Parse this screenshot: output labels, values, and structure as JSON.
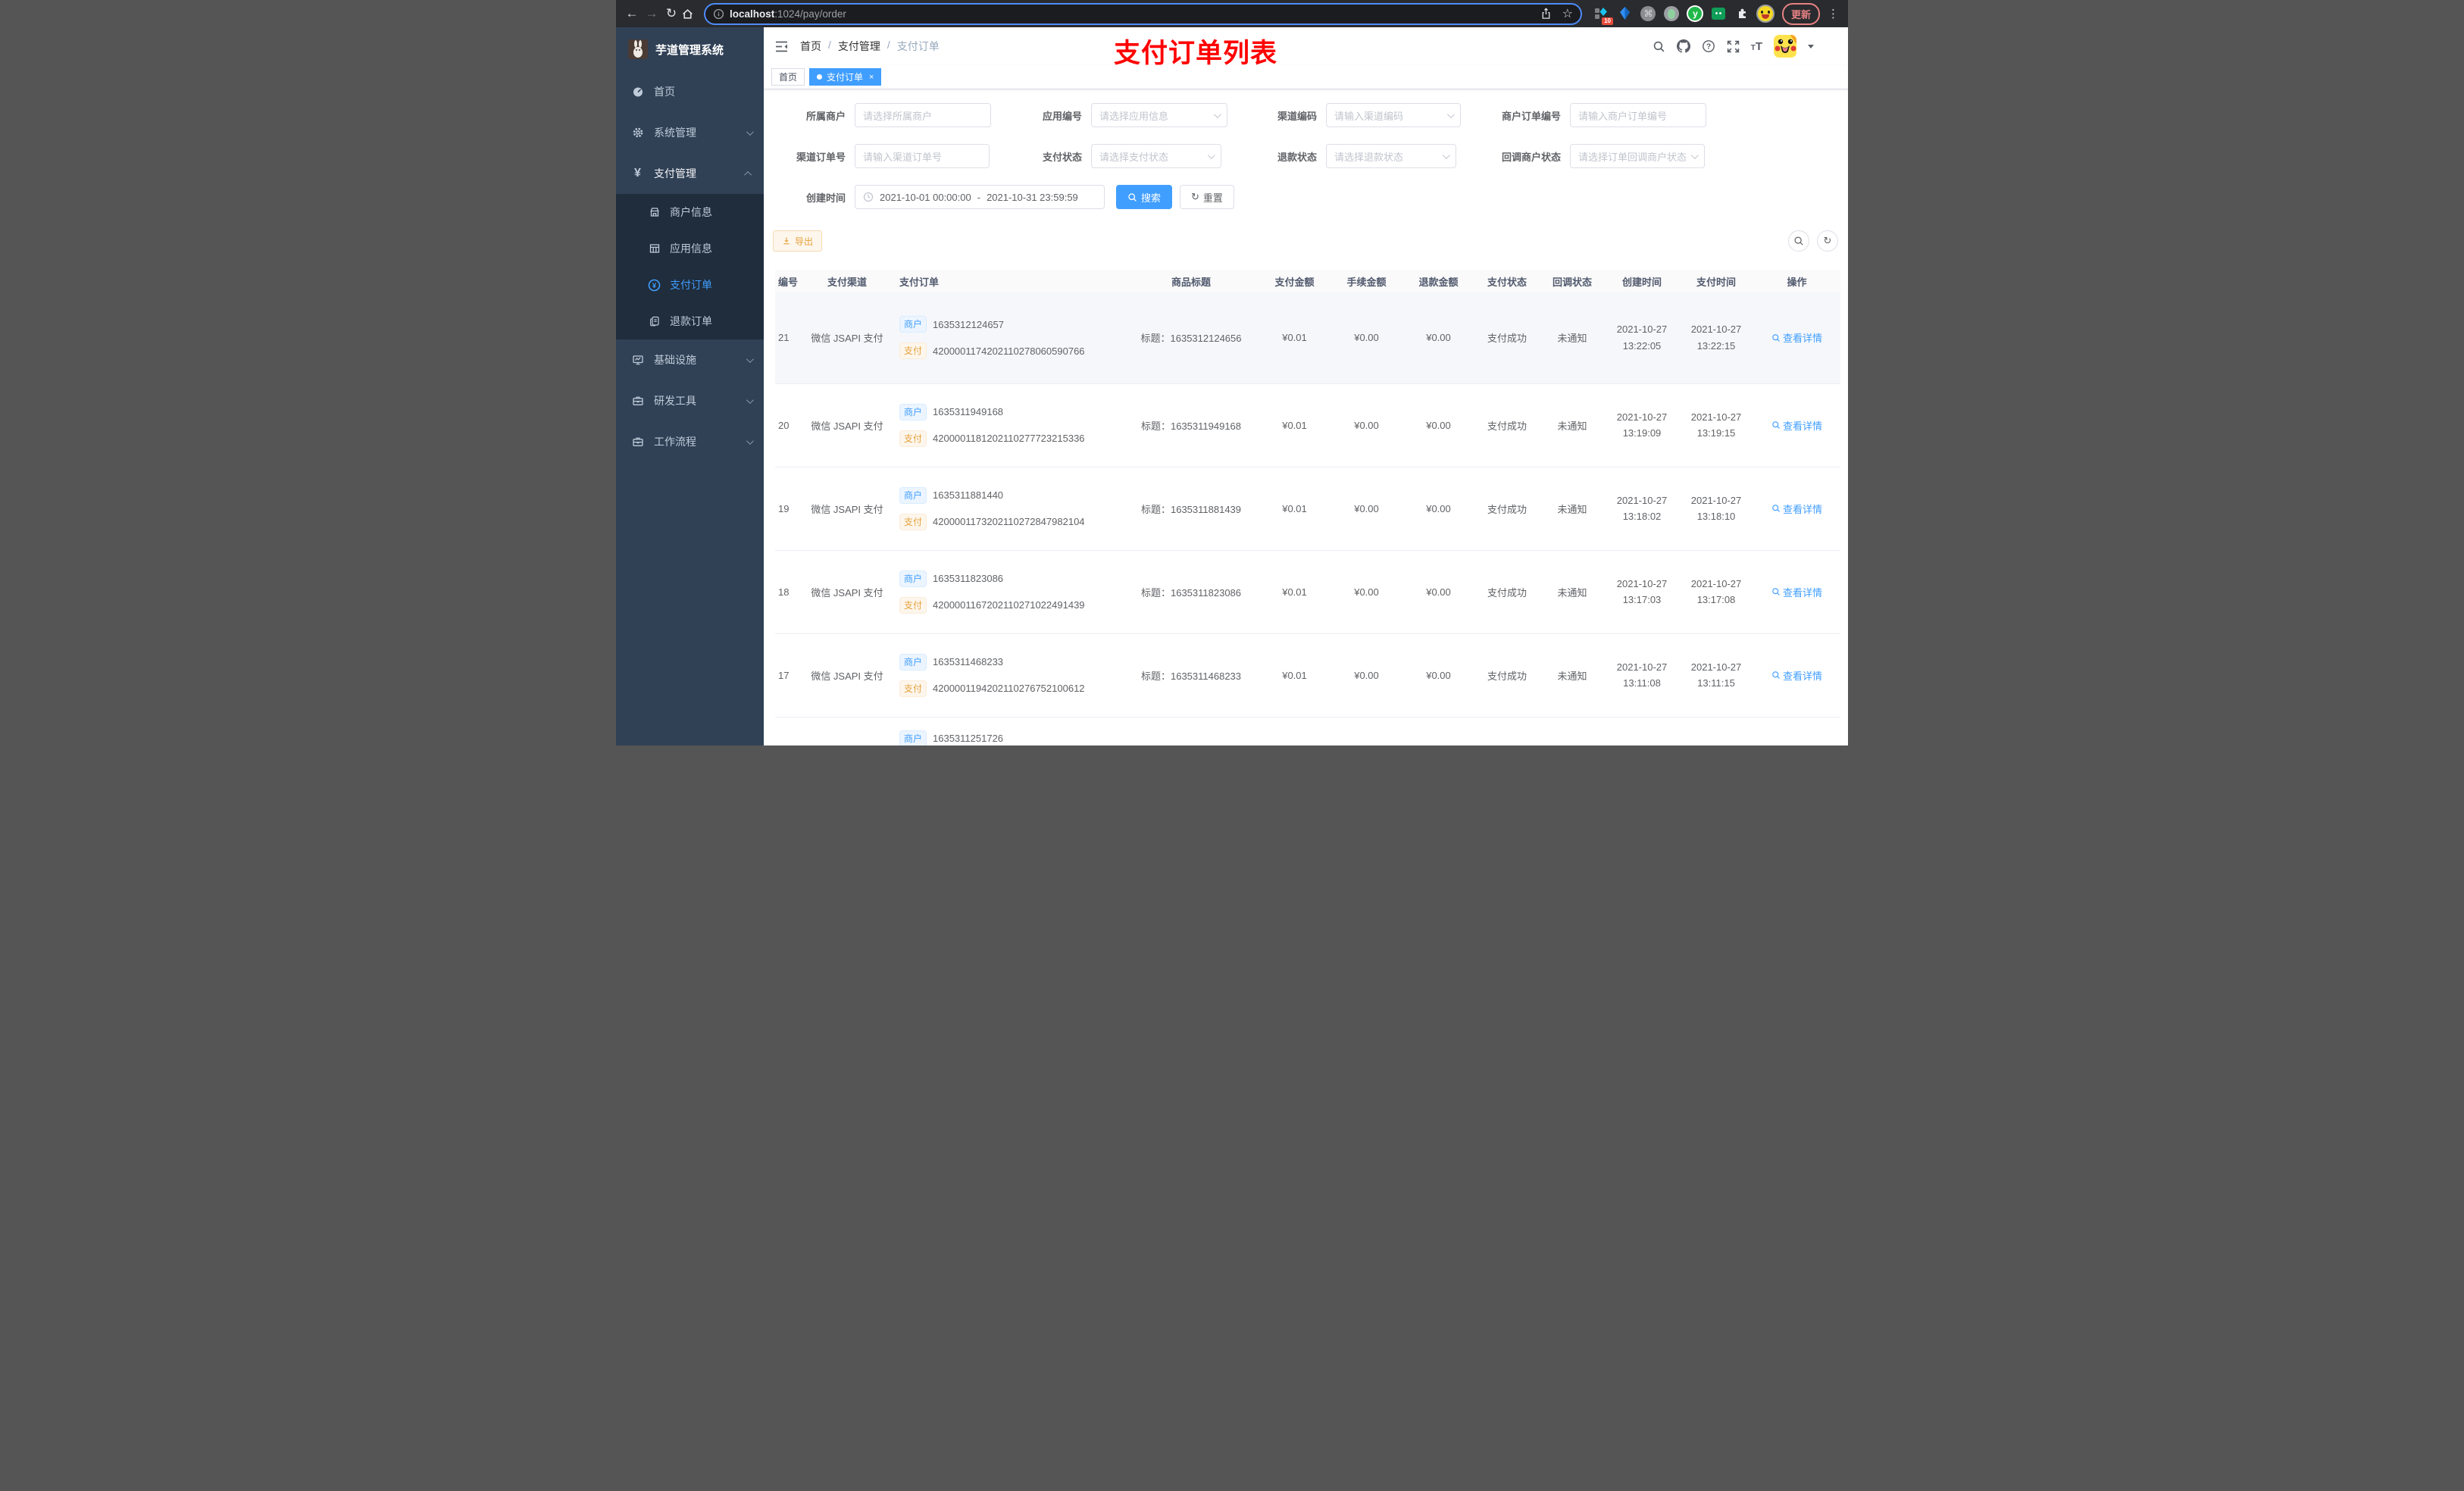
{
  "browser": {
    "url_host": "localhost",
    "url_rest": ":1024/pay/order",
    "update_label": "更新",
    "extension_badge": "10"
  },
  "icons": {
    "back": "←",
    "forward": "→",
    "reload": "↻",
    "star": "☆",
    "dots": "⋮",
    "cmd": "⌘",
    "refresh": "↻",
    "yen": "¥",
    "circle_yen": "¥",
    "help_mark": "?",
    "info_mark": "i",
    "tt_small": "T",
    "tt_big": "T",
    "y_ext": "y"
  },
  "sidebar": {
    "app_title": "芋道管理系统",
    "items": [
      {
        "label": "首页"
      },
      {
        "label": "系统管理"
      },
      {
        "label": "支付管理"
      },
      {
        "label": "基础设施"
      },
      {
        "label": "研发工具"
      },
      {
        "label": "工作流程"
      }
    ],
    "subitems": [
      {
        "label": "商户信息"
      },
      {
        "label": "应用信息"
      },
      {
        "label": "支付订单"
      },
      {
        "label": "退款订单"
      }
    ]
  },
  "navbar": {
    "breadcrumb": [
      "首页",
      "支付管理",
      "支付订单"
    ],
    "separator": "/",
    "annotation": "支付订单列表"
  },
  "tags": {
    "home": "首页",
    "active": "支付订单",
    "close": "×"
  },
  "filters": {
    "merchant": {
      "label": "所属商户",
      "placeholder": "请选择所属商户"
    },
    "app": {
      "label": "应用编号",
      "placeholder": "请选择应用信息"
    },
    "channel_code": {
      "label": "渠道编码",
      "placeholder": "请输入渠道编码"
    },
    "merchant_order_no": {
      "label": "商户订单编号",
      "placeholder": "请输入商户订单编号"
    },
    "channel_order_no": {
      "label": "渠道订单号",
      "placeholder": "请输入渠道订单号"
    },
    "pay_status": {
      "label": "支付状态",
      "placeholder": "请选择支付状态"
    },
    "refund_status": {
      "label": "退款状态",
      "placeholder": "请选择退款状态"
    },
    "notify_status": {
      "label": "回调商户状态",
      "placeholder": "请选择订单回调商户状态"
    },
    "create_time": {
      "label": "创建时间",
      "start": "2021-10-01 00:00:00",
      "separator": "-",
      "end": "2021-10-31 23:59:59"
    },
    "search_label": "搜索",
    "reset_label": "重置"
  },
  "toolbar": {
    "export_label": "导出"
  },
  "table": {
    "headers": [
      "编号",
      "支付渠道",
      "支付订单",
      "商品标题",
      "支付金额",
      "手续金额",
      "退款金额",
      "支付状态",
      "回调状态",
      "创建时间",
      "支付时间",
      "操作"
    ],
    "badge_merchant": "商户",
    "badge_pay": "支付",
    "rows": [
      {
        "id": "21",
        "channel": "微信 JSAPI 支付",
        "merchant_no": "1635312124657",
        "pay_no": "4200001174202110278060590766",
        "title": "标题：1635312124656",
        "amount": "¥0.01",
        "fee": "¥0.00",
        "refund": "¥0.00",
        "status": "支付成功",
        "notify": "未通知",
        "created_date": "2021-10-27",
        "created_time": "13:22:05",
        "paid_date": "2021-10-27",
        "paid_time": "13:22:15",
        "action": "查看详情"
      },
      {
        "id": "20",
        "channel": "微信 JSAPI 支付",
        "merchant_no": "1635311949168",
        "pay_no": "4200001181202110277723215336",
        "title": "标题：1635311949168",
        "amount": "¥0.01",
        "fee": "¥0.00",
        "refund": "¥0.00",
        "status": "支付成功",
        "notify": "未通知",
        "created_date": "2021-10-27",
        "created_time": "13:19:09",
        "paid_date": "2021-10-27",
        "paid_time": "13:19:15",
        "action": "查看详情"
      },
      {
        "id": "19",
        "channel": "微信 JSAPI 支付",
        "merchant_no": "1635311881440",
        "pay_no": "4200001173202110272847982104",
        "title": "标题：1635311881439",
        "amount": "¥0.01",
        "fee": "¥0.00",
        "refund": "¥0.00",
        "status": "支付成功",
        "notify": "未通知",
        "created_date": "2021-10-27",
        "created_time": "13:18:02",
        "paid_date": "2021-10-27",
        "paid_time": "13:18:10",
        "action": "查看详情"
      },
      {
        "id": "18",
        "channel": "微信 JSAPI 支付",
        "merchant_no": "1635311823086",
        "pay_no": "4200001167202110271022491439",
        "title": "标题：1635311823086",
        "amount": "¥0.01",
        "fee": "¥0.00",
        "refund": "¥0.00",
        "status": "支付成功",
        "notify": "未通知",
        "created_date": "2021-10-27",
        "created_time": "13:17:03",
        "paid_date": "2021-10-27",
        "paid_time": "13:17:08",
        "action": "查看详情"
      },
      {
        "id": "17",
        "channel": "微信 JSAPI 支付",
        "merchant_no": "1635311468233",
        "pay_no": "4200001194202110276752100612",
        "title": "标题：1635311468233",
        "amount": "¥0.01",
        "fee": "¥0.00",
        "refund": "¥0.00",
        "status": "支付成功",
        "notify": "未通知",
        "created_date": "2021-10-27",
        "created_time": "13:11:08",
        "paid_date": "2021-10-27",
        "paid_time": "13:11:15",
        "action": "查看详情"
      }
    ],
    "partial_row": {
      "merchant_no": "1635311251726"
    }
  }
}
